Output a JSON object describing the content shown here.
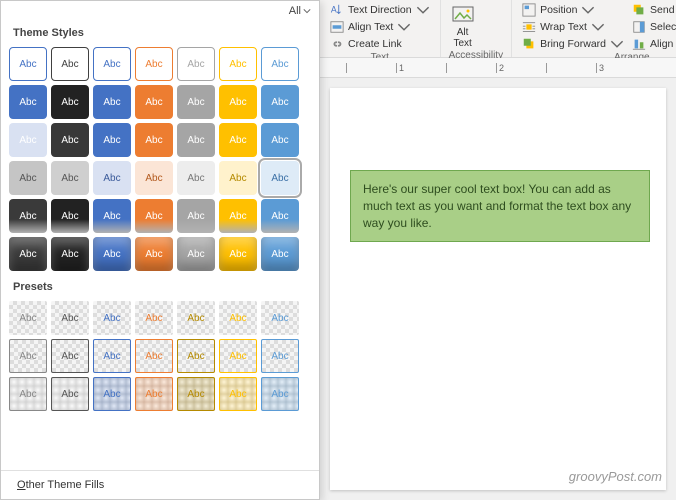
{
  "dropdown": {
    "all_label": "All",
    "theme_styles_label": "Theme Styles",
    "presets_label": "Presets",
    "other_fills_label": "Other Theme Fills",
    "swatch_text": "Abc",
    "palette": {
      "outline": [
        "#4472c4",
        "#404040",
        "#4472c4",
        "#ed7d31",
        "#a5a5a5",
        "#ffc000",
        "#5b9bd5",
        "#70ad47"
      ],
      "solid": [
        "#4472c4",
        "#222222",
        "#4472c4",
        "#ed7d31",
        "#a5a5a5",
        "#ffc000",
        "#5b9bd5",
        "#70ad47"
      ],
      "tint": [
        "#d9e1f2",
        "#383838",
        "#4472c4",
        "#ed7d31",
        "#a5a5a5",
        "#ffc000",
        "#5b9bd5",
        "#70ad47"
      ],
      "lightbg": [
        "#c5c5c5",
        "#cfcfcf",
        "#d9e1f2",
        "#fbe5d6",
        "#ededed",
        "#fff2cc",
        "#deebf7",
        "#e2efda"
      ],
      "lightbg_tx": [
        "#555",
        "#555",
        "#3a5a9a",
        "#b35a1e",
        "#777",
        "#b58a00",
        "#3a6fa5",
        "#4e7d33"
      ],
      "grad": [
        "#3a3a3a",
        "#222222",
        "#4472c4",
        "#ed7d31",
        "#a5a5a5",
        "#ffc000",
        "#5b9bd5",
        "#70ad47"
      ],
      "g3d": [
        "#3a3a3a",
        "#222222",
        "#4472c4",
        "#ed7d31",
        "#a5a5a5",
        "#ffc000",
        "#5b9bd5",
        "#70ad47"
      ]
    },
    "selected_row": 3,
    "selected_col": 6,
    "preset_colors": [
      "#888",
      "#555",
      "#4472c4",
      "#ed7d31",
      "#b58a00",
      "#ffc000",
      "#5b9bd5",
      "#70ad47"
    ]
  },
  "ribbon": {
    "text_group": {
      "label": "Text",
      "text_direction": "Text Direction",
      "align_text": "Align Text",
      "create_link": "Create Link"
    },
    "accessibility_group": {
      "label": "Accessibility",
      "alt_text": "Alt\nText"
    },
    "arrange_group": {
      "label": "Arrange",
      "position": "Position",
      "wrap_text": "Wrap Text",
      "bring_forward": "Bring Forward",
      "send_backward": "Send Backward",
      "selection_pane": "Selection Pane",
      "align": "Align"
    }
  },
  "ruler_marks": [
    "1",
    "2",
    "3"
  ],
  "textbox_content": "Here's our super cool text box! You can add as much text as you want and format the text box any way you like.",
  "watermark": "groovyPost.com"
}
